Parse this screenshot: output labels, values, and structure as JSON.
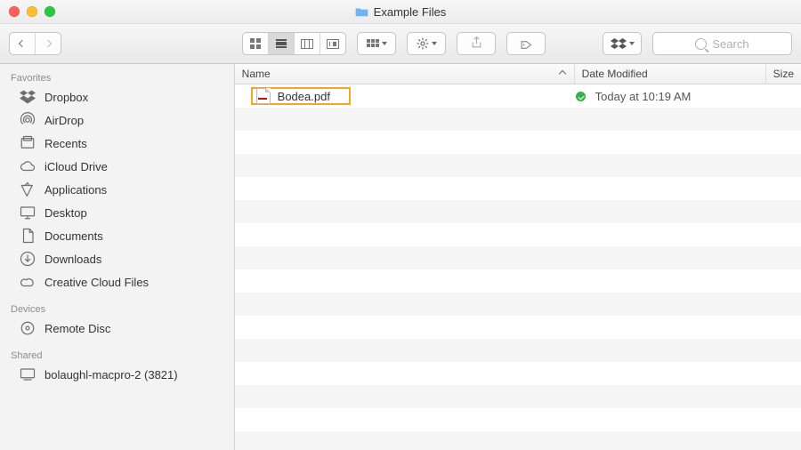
{
  "window": {
    "title": "Example Files"
  },
  "toolbar": {
    "search_placeholder": "Search"
  },
  "columns": {
    "name": "Name",
    "date": "Date Modified",
    "size": "Size"
  },
  "sidebar": {
    "sections": [
      {
        "header": "Favorites",
        "items": [
          {
            "icon": "dropbox-icon",
            "label": "Dropbox"
          },
          {
            "icon": "airdrop-icon",
            "label": "AirDrop"
          },
          {
            "icon": "recents-icon",
            "label": "Recents"
          },
          {
            "icon": "cloud-icon",
            "label": "iCloud Drive"
          },
          {
            "icon": "apps-icon",
            "label": "Applications"
          },
          {
            "icon": "desktop-icon",
            "label": "Desktop"
          },
          {
            "icon": "documents-icon",
            "label": "Documents"
          },
          {
            "icon": "downloads-icon",
            "label": "Downloads"
          },
          {
            "icon": "creative-cloud-icon",
            "label": "Creative Cloud Files"
          }
        ]
      },
      {
        "header": "Devices",
        "items": [
          {
            "icon": "disc-icon",
            "label": "Remote Disc"
          }
        ]
      },
      {
        "header": "Shared",
        "items": [
          {
            "icon": "computer-icon",
            "label": "bolaughl-macpro-2 (3821)"
          }
        ]
      }
    ]
  },
  "files": [
    {
      "name": "Bodea.pdf",
      "synced": true,
      "date": "Today at 10:19 AM",
      "size": "",
      "highlighted": true
    }
  ]
}
